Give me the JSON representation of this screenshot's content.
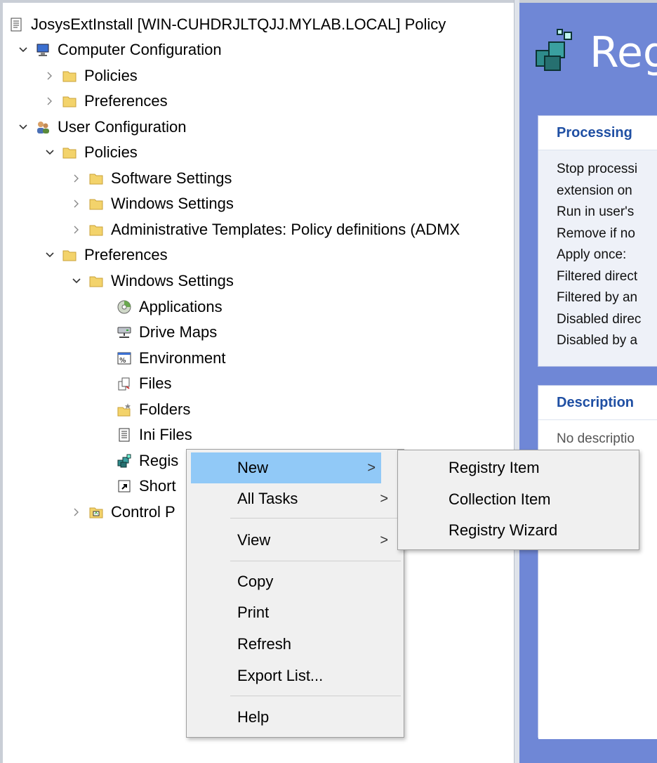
{
  "tree": {
    "root": "JosysExtInstall [WIN-CUHDRJLTQJJ.MYLAB.LOCAL] Policy",
    "computer_configuration": "Computer Configuration",
    "cc_policies": "Policies",
    "cc_preferences": "Preferences",
    "user_configuration": "User Configuration",
    "uc_policies": "Policies",
    "software_settings": "Software Settings",
    "windows_settings": "Windows Settings",
    "admin_templates": "Administrative Templates: Policy definitions (ADMX",
    "uc_preferences": "Preferences",
    "pref_windows_settings": "Windows Settings",
    "applications": "Applications",
    "drive_maps": "Drive Maps",
    "environment": "Environment",
    "files": "Files",
    "folders": "Folders",
    "ini_files": "Ini Files",
    "registry": "Regis",
    "shortcuts": "Short",
    "control_panel": "Control P"
  },
  "right_pane": {
    "title": "Reg",
    "processing": {
      "heading": "Processing",
      "lines": [
        "Stop processi",
        "extension on",
        "Run in user's",
        "Remove if no",
        "Apply once:",
        "Filtered direct",
        "Filtered by an",
        "Disabled direc",
        "Disabled by a"
      ]
    },
    "description": {
      "heading": "Description",
      "text": "No descriptio"
    }
  },
  "context_menu": {
    "new": "New",
    "all_tasks": "All Tasks",
    "view": "View",
    "copy": "Copy",
    "print": "Print",
    "refresh": "Refresh",
    "export_list": "Export List...",
    "help": "Help",
    "arrow": ">"
  },
  "submenu": {
    "registry_item": "Registry Item",
    "collection_item": "Collection Item",
    "registry_wizard": "Registry Wizard"
  },
  "colors": {
    "right_pane_bg": "#6f87d6",
    "menu_hover": "#91c9f7",
    "panel_heading": "#1f4fa3",
    "folder": "#f3d36b"
  }
}
